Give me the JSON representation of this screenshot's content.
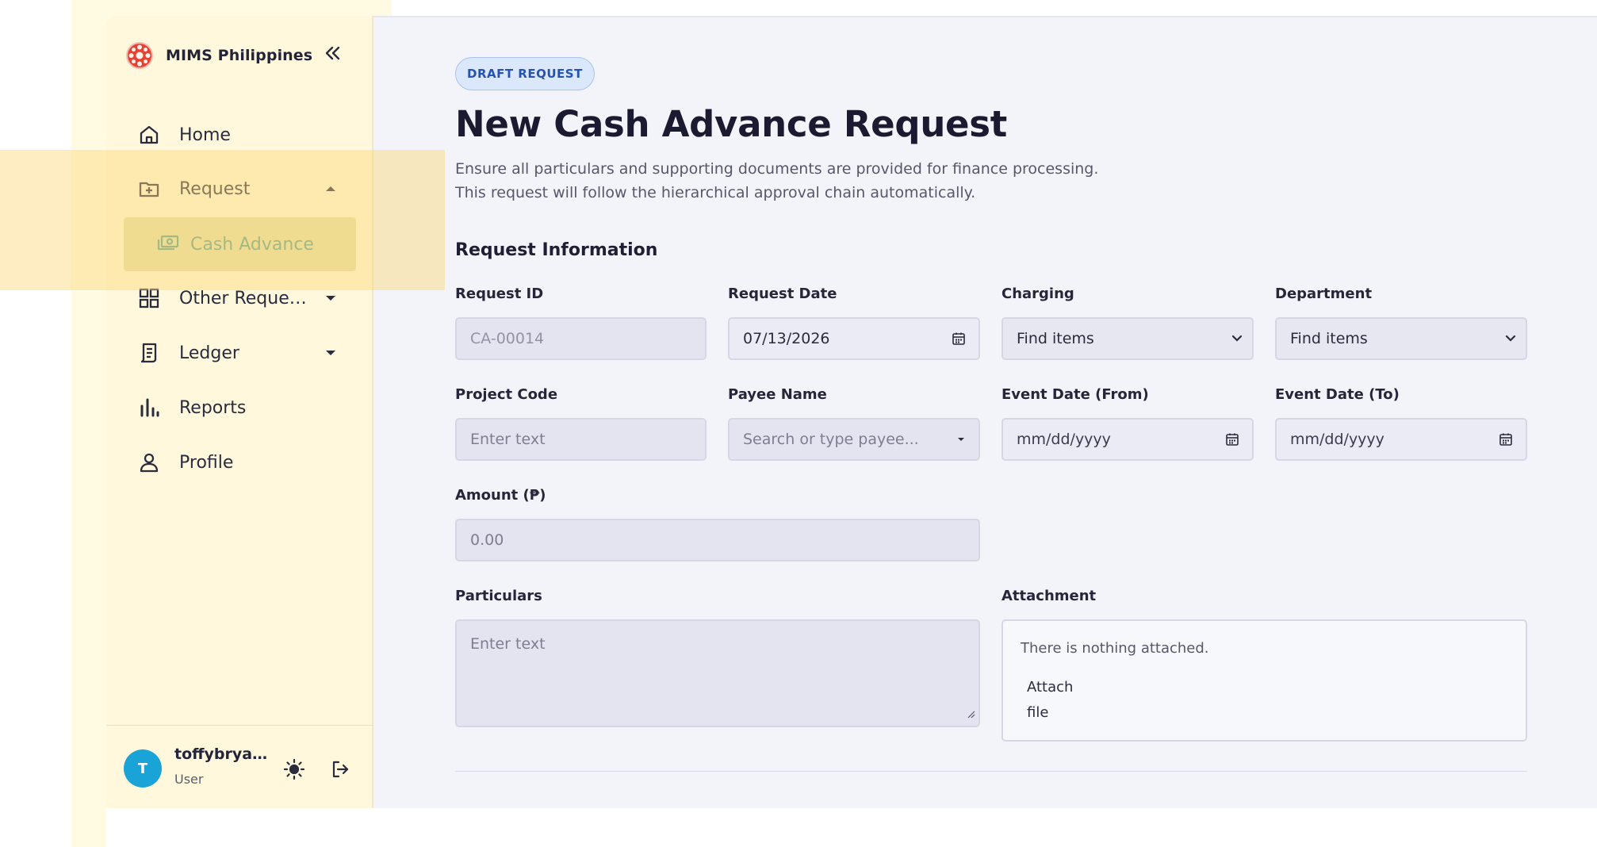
{
  "brand": {
    "name": "MIMS Philippines"
  },
  "sidebar": {
    "items": [
      {
        "label": "Home",
        "icon": "home-icon"
      },
      {
        "label": "Request",
        "icon": "folder-plus-icon",
        "expanded": true
      },
      {
        "label": "Other Requests",
        "icon": "grid-icon"
      },
      {
        "label": "Ledger",
        "icon": "receipt-icon"
      },
      {
        "label": "Reports",
        "icon": "bar-chart-icon"
      },
      {
        "label": "Profile",
        "icon": "user-icon"
      }
    ],
    "sub_item": {
      "label": "Cash Advance",
      "icon": "money-icon"
    }
  },
  "user": {
    "initial": "T",
    "name": "toffybryan...",
    "role": "User"
  },
  "page": {
    "badge": "DRAFT REQUEST",
    "title": "New Cash Advance Request",
    "desc_line1": "Ensure all particulars and supporting documents are provided for finance processing.",
    "desc_line2": "This request will follow the hierarchical approval chain automatically.",
    "section": "Request Information"
  },
  "form": {
    "request_id": {
      "label": "Request ID",
      "value": "CA-00014"
    },
    "request_date": {
      "label": "Request Date",
      "value": "07/13/2026"
    },
    "charging": {
      "label": "Charging",
      "value": "Find items"
    },
    "department": {
      "label": "Department",
      "value": "Find items"
    },
    "project_code": {
      "label": "Project Code",
      "placeholder": "Enter text"
    },
    "payee_name": {
      "label": "Payee Name",
      "placeholder": "Search or type payee..."
    },
    "event_from": {
      "label": "Event Date (From)",
      "placeholder": "mm/dd/yyyy"
    },
    "event_to": {
      "label": "Event Date (To)",
      "placeholder": "mm/dd/yyyy"
    },
    "amount": {
      "label": "Amount (₱)",
      "placeholder": "0.00"
    },
    "particulars": {
      "label": "Particulars",
      "placeholder": "Enter text"
    },
    "attachment": {
      "label": "Attachment",
      "empty_text": "There is nothing attached.",
      "button": "Attach file"
    }
  },
  "colors": {
    "sidebar_bg": "#fff8dd",
    "highlight": "#fcd678",
    "accent_green": "#5ea08d",
    "badge_blue": "#2553b3",
    "avatar": "#19a3d6"
  }
}
